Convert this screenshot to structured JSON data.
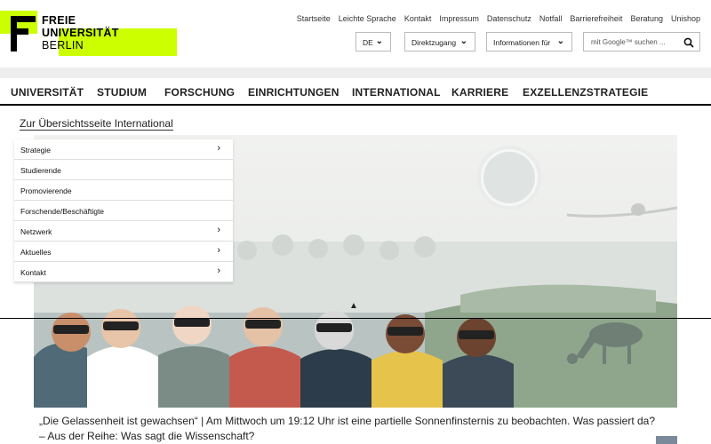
{
  "logo": {
    "line1": "FREIE",
    "line2": "UNIVERSITÄT",
    "line3": "BERLIN"
  },
  "topnav": [
    "Startseite",
    "Leichte Sprache",
    "Kontakt",
    "Impressum",
    "Datenschutz",
    "Notfall",
    "Barrierefreiheit",
    "Beratung",
    "Unishop"
  ],
  "tools": {
    "language": "DE",
    "direct_access": "Direktzugang",
    "info_for": "Informationen für",
    "search_placeholder": "mit Google™ suchen ..."
  },
  "mainnav": [
    "UNIVERSITÄT",
    "STUDIUM",
    "FORSCHUNG",
    "EINRICHTUNGEN",
    "INTERNATIONAL",
    "KARRIERE",
    "EXZELLENZSTRATEGIE"
  ],
  "section_link": "Zur Übersichtsseite International",
  "submenu": [
    {
      "label": "Strategie",
      "has_children": true
    },
    {
      "label": "Studierende",
      "has_children": false
    },
    {
      "label": "Promovierende",
      "has_children": false
    },
    {
      "label": "Forschende/Beschäftigte",
      "has_children": false
    },
    {
      "label": "Netzwerk",
      "has_children": true
    },
    {
      "label": "Aktuelles",
      "has_children": true
    },
    {
      "label": "Kontakt",
      "has_children": true
    }
  ],
  "caption": {
    "line1": "„Die Gelassenheit ist gewachsen“ | Am Mittwoch um 19:12 Uhr ist eine partielle Sonnenfinsternis zu beobachten. Was passiert da?",
    "line2": "– Aus der Reihe: Was sagt die Wissenschaft?"
  },
  "colors": {
    "brand_green": "#ccff00",
    "sky": "#eef0ee",
    "meadow": "#7a9a78"
  }
}
